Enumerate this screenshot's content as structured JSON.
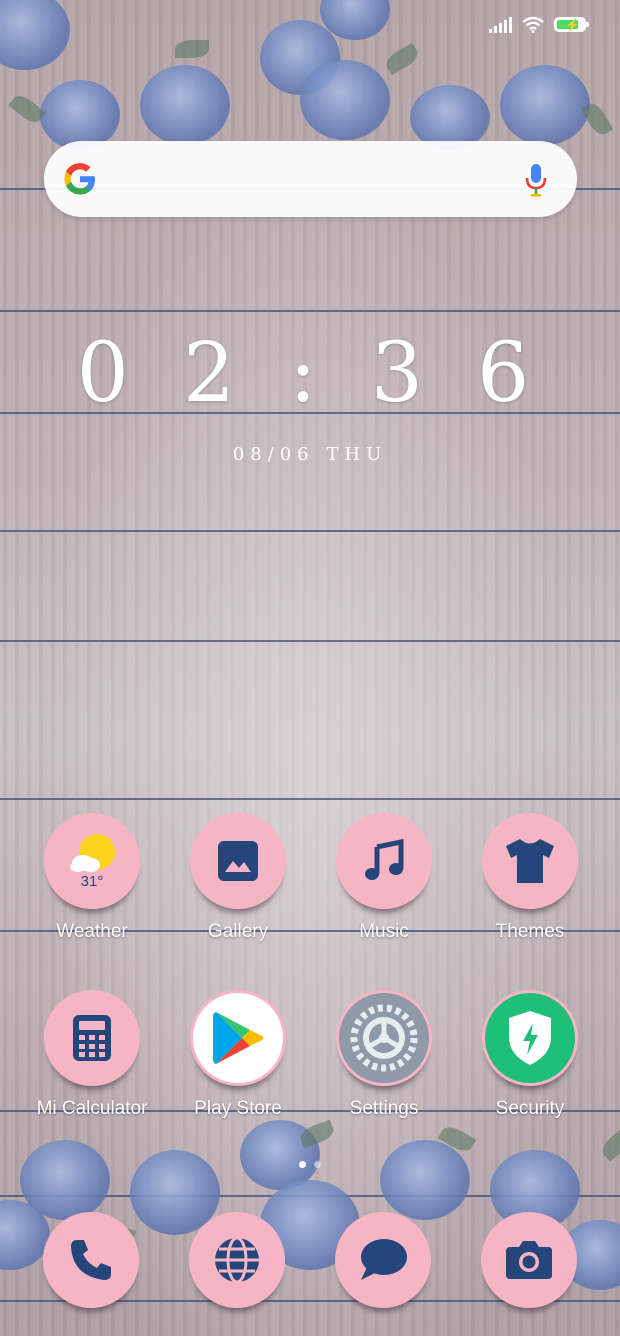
{
  "status_bar": {
    "signal_icon": "signal-bars-icon",
    "wifi_icon": "wifi-icon",
    "battery_icon": "battery-charging-icon",
    "battery_level": 0.74
  },
  "search_bar": {
    "logo_icon": "google-g-icon",
    "mic_icon": "microphone-icon"
  },
  "clock": {
    "time": "02:36",
    "date": "08/06 THU"
  },
  "apps_row1": [
    {
      "label": "Weather",
      "icon": "weather-sun-cloud-icon",
      "temp": "31°"
    },
    {
      "label": "Gallery",
      "icon": "gallery-image-icon"
    },
    {
      "label": "Music",
      "icon": "music-note-icon"
    },
    {
      "label": "Themes",
      "icon": "tshirt-icon"
    }
  ],
  "apps_row2": [
    {
      "label": "Mi Calculator",
      "icon": "calculator-icon"
    },
    {
      "label": "Play Store",
      "icon": "play-store-icon"
    },
    {
      "label": "Settings",
      "icon": "settings-gear-icon"
    },
    {
      "label": "Security",
      "icon": "security-shield-icon"
    }
  ],
  "page_indicator": {
    "pages": 2,
    "active": 1
  },
  "dock": [
    {
      "icon": "phone-icon"
    },
    {
      "icon": "browser-globe-icon"
    },
    {
      "icon": "messages-bubble-icon"
    },
    {
      "icon": "camera-icon"
    }
  ],
  "colors": {
    "icon_bg": "#f6b5c4",
    "icon_glyph": "#25467a",
    "security_green": "#1fbf7a",
    "settings_gray": "#8e9aa8"
  }
}
